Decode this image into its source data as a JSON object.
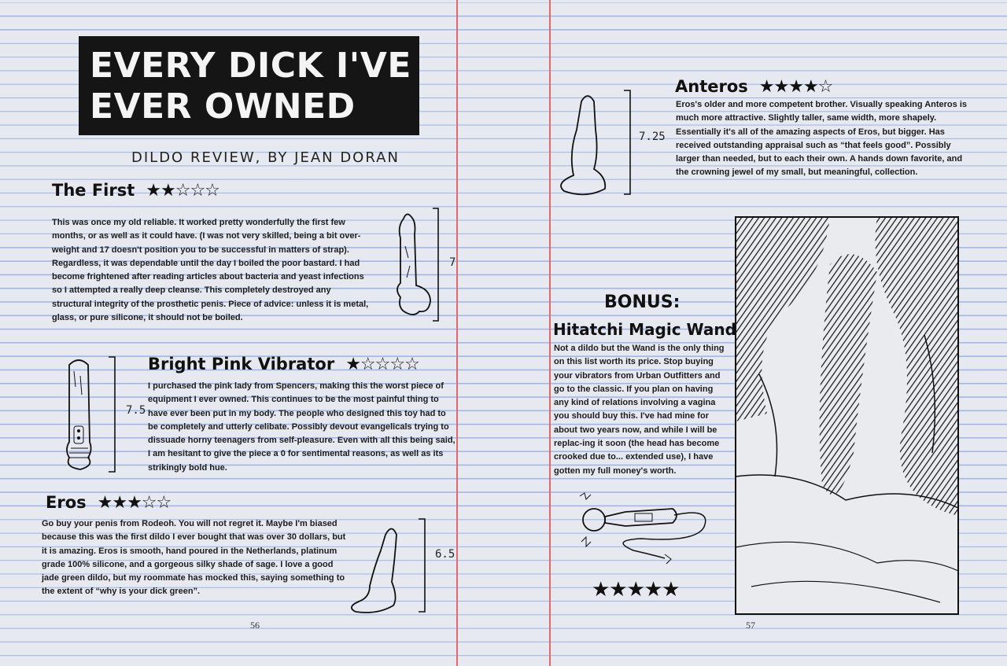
{
  "spread": {
    "title_line1": "EVERY DICK I'VE",
    "title_line2": "EVER OWNED",
    "byline": "DILDO REVIEW, BY JEAN DORAN",
    "page_left": "56",
    "page_right": "57"
  },
  "reviews": [
    {
      "name": "The First",
      "rating": 2,
      "stars": "★★☆☆☆",
      "length": "7",
      "text": "This was once my old reliable. It worked pretty wonderfully the first few months, or as well as it could have. (I was not very skilled, being a bit over-weight and 17 doesn't position you to be successful in matters of strap). Regardless, it was dependable until the day I boiled the poor bastard. I had become frightened after reading articles about bacteria and yeast infections so I attempted a really deep cleanse. This completely destroyed any structural integrity of the prosthetic penis. Piece of advice: unless it is metal, glass, or pure silicone, it should not be boiled."
    },
    {
      "name": "Bright Pink Vibrator",
      "rating": 1,
      "stars": "★☆☆☆☆",
      "length": "7.5",
      "text": "I purchased the pink lady from Spencers, making this the worst piece of equipment I ever owned. This continues to be the most painful thing to have ever been put in my body. The people who designed this toy had to be completely and utterly celibate. Possibly devout evangelicals trying to dissuade horny teenagers from self-pleasure. Even with all this being said, I am hesitant to give the piece a 0 for sentimental reasons, as well as its strikingly bold hue."
    },
    {
      "name": "Eros",
      "rating": 3,
      "stars": "★★★☆☆",
      "length": "6.5",
      "text": "Go buy your penis from Rodeoh. You will not regret it. Maybe I'm biased because this was the first dildo I ever bought that was over 30 dollars, but it is amazing. Eros is smooth, hand poured in the Netherlands, platinum grade 100% silicone, and a gorgeous silky shade of sage. I love a good jade green dildo, but my roommate has mocked this, saying something to the extent of “why is your dick green”."
    },
    {
      "name": "Anteros",
      "rating": 4,
      "stars": "★★★★☆",
      "length": "7.25",
      "text": "Eros's older and more competent brother.  Visually speaking Anteros is much more attractive. Slightly taller, same width, more shapely. Essentially it's all of the amazing aspects of Eros, but bigger. Has received outstanding appraisal such as “that feels good”.  Possibly larger than needed, but to each their own. A hands down favorite, and the crowning jewel of my small, but meaningful, collection."
    }
  ],
  "bonus": {
    "label": "BONUS:",
    "name": "Hitatchi Magic Wand",
    "rating": 5,
    "stars": "★★★★★",
    "text": "Not a dildo but the Wand is the only thing on this list worth its price. Stop buying your vibrators from Urban Outfitters and go to the classic. If you plan on having any kind of relations involving a vagina you should buy this. I've had mine for about two years now, and while I will be replac-ing it soon (the head has become crooked due to... extended use), I have gotten my full money's worth."
  },
  "colors": {
    "paper": "#e6e9ef",
    "rule_line": "#9fb5e6",
    "margin_line": "#e06a6a",
    "ink": "#151515"
  }
}
